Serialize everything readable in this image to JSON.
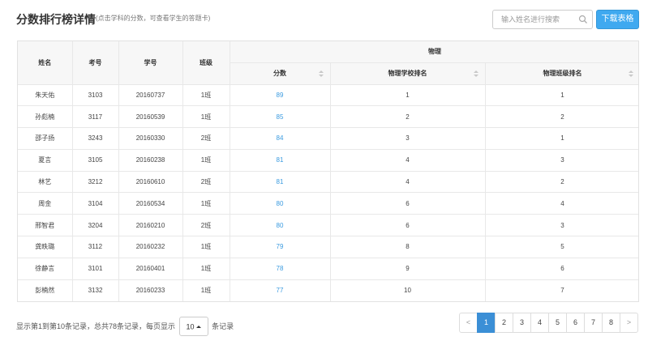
{
  "header": {
    "title": "分数排行榜详情",
    "subtitle": "(点击学科的分数，可查看学生的答题卡)",
    "search_placeholder": "输入姓名进行搜索",
    "search_icon": "search-icon",
    "download_label": "下载表格"
  },
  "table": {
    "columns": {
      "name": "姓名",
      "exam_no": "考号",
      "student_no": "学号",
      "class": "班级",
      "subject": "物理",
      "score": "分数",
      "school_rank": "物理学校排名",
      "class_rank": "物理班级排名"
    },
    "rows": [
      {
        "name": "朱天佑",
        "exam_no": "3103",
        "student_no": "20160737",
        "class": "1班",
        "score": "89",
        "school_rank": "1",
        "class_rank": "1"
      },
      {
        "name": "孙彪楠",
        "exam_no": "3117",
        "student_no": "20160539",
        "class": "1班",
        "score": "85",
        "school_rank": "2",
        "class_rank": "2"
      },
      {
        "name": "邵子扬",
        "exam_no": "3243",
        "student_no": "20160330",
        "class": "2班",
        "score": "84",
        "school_rank": "3",
        "class_rank": "1"
      },
      {
        "name": "夏言",
        "exam_no": "3105",
        "student_no": "20160238",
        "class": "1班",
        "score": "81",
        "school_rank": "4",
        "class_rank": "3"
      },
      {
        "name": "林艺",
        "exam_no": "3212",
        "student_no": "20160610",
        "class": "2班",
        "score": "81",
        "school_rank": "4",
        "class_rank": "2"
      },
      {
        "name": "周金",
        "exam_no": "3104",
        "student_no": "20160534",
        "class": "1班",
        "score": "80",
        "school_rank": "6",
        "class_rank": "4"
      },
      {
        "name": "邢智君",
        "exam_no": "3204",
        "student_no": "20160210",
        "class": "2班",
        "score": "80",
        "school_rank": "6",
        "class_rank": "3"
      },
      {
        "name": "龚昳璐",
        "exam_no": "3112",
        "student_no": "20160232",
        "class": "1班",
        "score": "79",
        "school_rank": "8",
        "class_rank": "5"
      },
      {
        "name": "徐静言",
        "exam_no": "3101",
        "student_no": "20160401",
        "class": "1班",
        "score": "78",
        "school_rank": "9",
        "class_rank": "6"
      },
      {
        "name": "彭楠然",
        "exam_no": "3132",
        "student_no": "20160233",
        "class": "1班",
        "score": "77",
        "school_rank": "10",
        "class_rank": "7"
      }
    ]
  },
  "footer": {
    "info_prefix": "显示第1到第10条记录，总共78条记录，每页显示",
    "page_size": "10",
    "info_suffix": "条记录"
  },
  "pagination": {
    "prev": "<",
    "pages": [
      "1",
      "2",
      "3",
      "4",
      "5",
      "6",
      "7",
      "8"
    ],
    "active": "1",
    "next": ">"
  },
  "colors": {
    "accent": "#3fa9f0",
    "score_link": "#3b9be0",
    "active_page": "#3b8fd6"
  }
}
